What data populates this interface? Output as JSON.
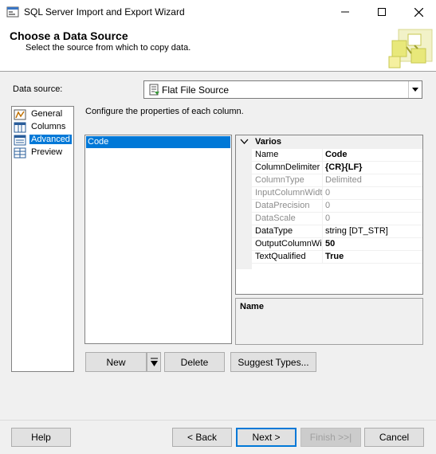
{
  "window": {
    "title": "SQL Server Import and Export Wizard",
    "app_icon": "wizard-app-icon",
    "controls": [
      "minimize-icon",
      "maximize-icon",
      "close-icon"
    ]
  },
  "header": {
    "title": "Choose a Data Source",
    "subtitle": "Select the source from which to copy data.",
    "logo_icon": "wizard-logo-icon"
  },
  "data_source": {
    "label": "Data source:",
    "selected": "Flat File Source",
    "icon": "flat-file-icon"
  },
  "nav": {
    "items": [
      {
        "label": "General",
        "icon": "general-icon",
        "selected": false
      },
      {
        "label": "Columns",
        "icon": "columns-icon",
        "selected": false
      },
      {
        "label": "Advanced",
        "icon": "advanced-icon",
        "selected": true
      },
      {
        "label": "Preview",
        "icon": "preview-icon",
        "selected": false
      }
    ]
  },
  "main": {
    "instruction": "Configure the properties of each column.",
    "columns": [
      "Code"
    ],
    "property_grid": {
      "category": "Varios",
      "rows": [
        {
          "name": "Name",
          "value": "Code",
          "bold": true,
          "readonly": false
        },
        {
          "name": "ColumnDelimiter",
          "value": "{CR}{LF}",
          "bold": true,
          "readonly": false
        },
        {
          "name": "ColumnType",
          "value": "Delimited",
          "bold": false,
          "readonly": true
        },
        {
          "name": "InputColumnWidth",
          "value": "0",
          "bold": false,
          "readonly": true
        },
        {
          "name": "DataPrecision",
          "value": "0",
          "bold": false,
          "readonly": true
        },
        {
          "name": "DataScale",
          "value": "0",
          "bold": false,
          "readonly": true
        },
        {
          "name": "DataType",
          "value": "string [DT_STR]",
          "bold": false,
          "readonly": false
        },
        {
          "name": "OutputColumnWidth",
          "value": "50",
          "bold": true,
          "readonly": false
        },
        {
          "name": "TextQualified",
          "value": "True",
          "bold": true,
          "readonly": false
        }
      ]
    },
    "description": {
      "title": "Name"
    },
    "buttons": {
      "new": "New",
      "delete": "Delete",
      "suggest": "Suggest Types..."
    }
  },
  "footer": {
    "help": "Help",
    "back": "< Back",
    "next": "Next >",
    "finish": "Finish >>|",
    "cancel": "Cancel"
  },
  "colors": {
    "selection": "#0078d7",
    "disabled_text": "#8c8c8c",
    "dialog_bg": "#f0f0f0"
  }
}
